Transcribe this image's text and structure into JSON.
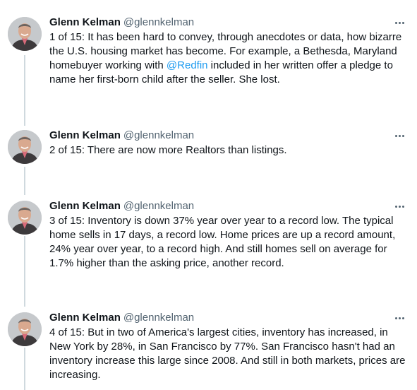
{
  "author": {
    "name": "Glenn Kelman",
    "handle": "@glennkelman"
  },
  "colors": {
    "text": "#0f1419",
    "secondary": "#536471",
    "link": "#1d9bf0",
    "thread_line": "#cfd9de"
  },
  "icons": {
    "avatar": "profile-photo",
    "more": "more-options-icon"
  },
  "tweets": [
    {
      "text_before": "1 of 15: It has been hard to convey, through anecdotes or data, how bizarre the U.S. housing market has become. For example, a Bethesda, Maryland homebuyer working with ",
      "mention": "@Redfin",
      "text_after": " included in her written offer a pledge to name her first-born child after the seller. She lost."
    },
    {
      "text": "2 of 15: There are now more Realtors than listings."
    },
    {
      "text": "3 of 15: Inventory is down 37% year over year to a record low. The typical home sells in 17 days, a record low. Home prices are up a record amount, 24% year over year, to a record high. And still homes sell on average for 1.7% higher than the asking price, another record."
    },
    {
      "text": "4 of 15: But in two of America's largest cities, inventory has increased, in New York by 28%, in San Francisco by 77%. San Francisco hasn't had an inventory increase this large since 2008. And still in both markets, prices are increasing."
    }
  ]
}
